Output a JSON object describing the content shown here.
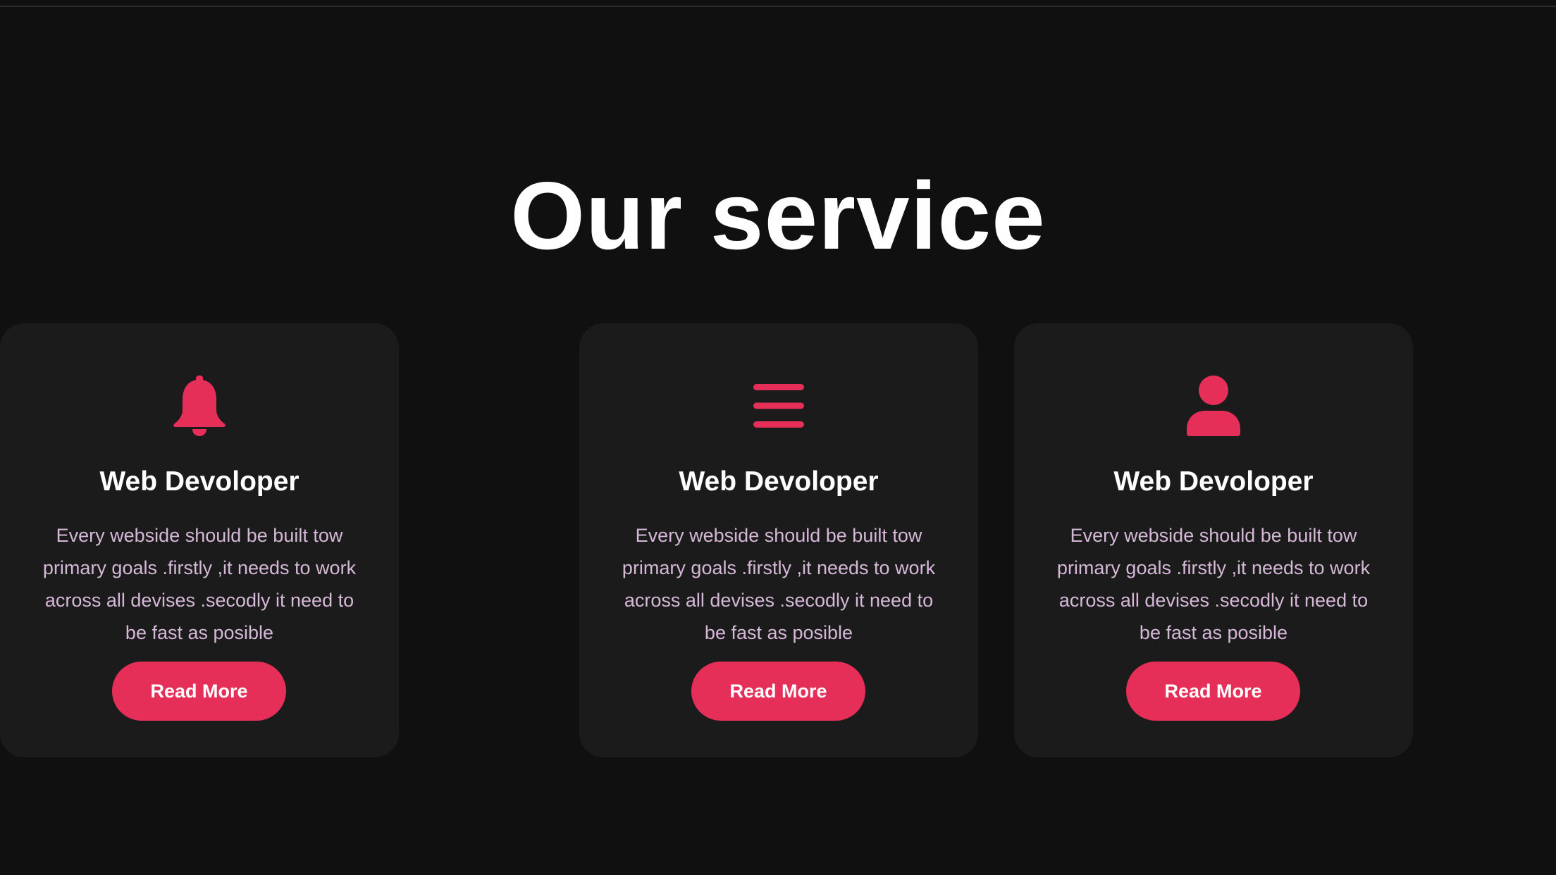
{
  "section": {
    "title": "Our service"
  },
  "colors": {
    "background": "#101010",
    "card": "#1b1b1b",
    "accent": "#e62f58",
    "heading": "#ffffff",
    "body_text": "#d5b8d7"
  },
  "cards": [
    {
      "icon": "menu-icon",
      "title": "Web Devoloper",
      "text": "Every webside should be built tow primary goals .firstly ,it needs to work across all devises .secodly it need to be fast as posible",
      "button_label": "Read More"
    },
    {
      "icon": "user-icon",
      "title": "Web Devoloper",
      "text": "Every webside should be built tow primary goals .firstly ,it needs to work across all devises .secodly it need to be fast as posible",
      "button_label": "Read More"
    },
    {
      "icon": "bell-icon",
      "title": "Web Devoloper",
      "text": "Every webside should be built tow primary goals .firstly ,it needs to work across all devises .secodly it need to be fast as posible",
      "button_label": "Read More"
    }
  ]
}
